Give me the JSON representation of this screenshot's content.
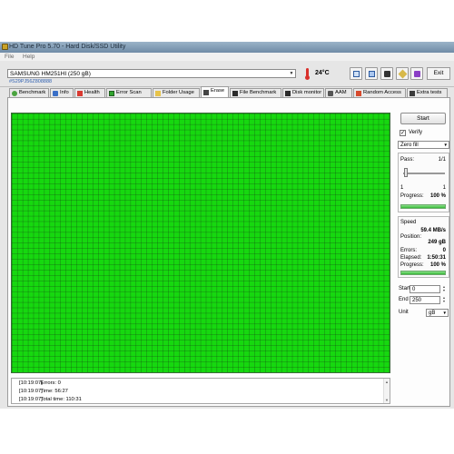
{
  "window": {
    "title": "HD Tune Pro 5.70 - Hard Disk/SSD Utility"
  },
  "menu": [
    "File",
    "Help"
  ],
  "toolbar": {
    "drive": "SAMSUNG HM251HI (250 gB)",
    "serial": "#S29PJ56Z808888",
    "temperature": "24°C",
    "exit_label": "Exit",
    "icons": [
      "copy-icon",
      "copy-all-icon",
      "camera-icon",
      "tag-icon",
      "download-icon"
    ]
  },
  "tabs": [
    {
      "label": "Benchmark",
      "icon": "gauge-icon"
    },
    {
      "label": "Info",
      "icon": "info-icon"
    },
    {
      "label": "Health",
      "icon": "plus-icon"
    },
    {
      "label": "Error Scan",
      "icon": "grid-icon"
    },
    {
      "label": "Folder Usage",
      "icon": "folder-icon"
    },
    {
      "label": "Erase",
      "icon": "trash-icon"
    },
    {
      "label": "File Benchmark",
      "icon": "file-icon"
    },
    {
      "label": "Disk monitor",
      "icon": "monitor-icon"
    },
    {
      "label": "AAM",
      "icon": "speaker-icon"
    },
    {
      "label": "Random Access",
      "icon": "random-icon"
    },
    {
      "label": "Extra tests",
      "icon": "tests-icon"
    }
  ],
  "active_tab": "Erase",
  "erase": {
    "start_label": "Start",
    "verify_label": "Verify",
    "verify_checked": true,
    "method": "Zero fill",
    "pass_label": "Pass:",
    "pass_value": "1/1",
    "slider_min": "1",
    "slider_max": "1",
    "progress_label": "Progress:",
    "progress_value": "100 %",
    "progress_fraction": 1.0,
    "speed_label": "Speed",
    "speed_value": "59.4 MB/s",
    "position_label": "Position:",
    "position_value": "249 gB",
    "errors_label": "Errors:",
    "errors_value": "0",
    "elapsed_label": "Elapsed:",
    "elapsed_value": "1:50:31",
    "progress2_label": "Progress:",
    "progress2_value": "100 %",
    "start_field_label": "Start",
    "start_field_value": "0",
    "end_field_label": "End",
    "end_field_value": "250",
    "unit_label": "Unit",
    "unit_value": "gB",
    "block_color": "#16d80f"
  },
  "log": [
    {
      "time": "[10:19:07]",
      "text": "Errors: 0"
    },
    {
      "time": "[10:19:07]",
      "text": "Time: 56:27"
    },
    {
      "time": "[10:19:07]",
      "text": "Total time: 110:31"
    }
  ]
}
